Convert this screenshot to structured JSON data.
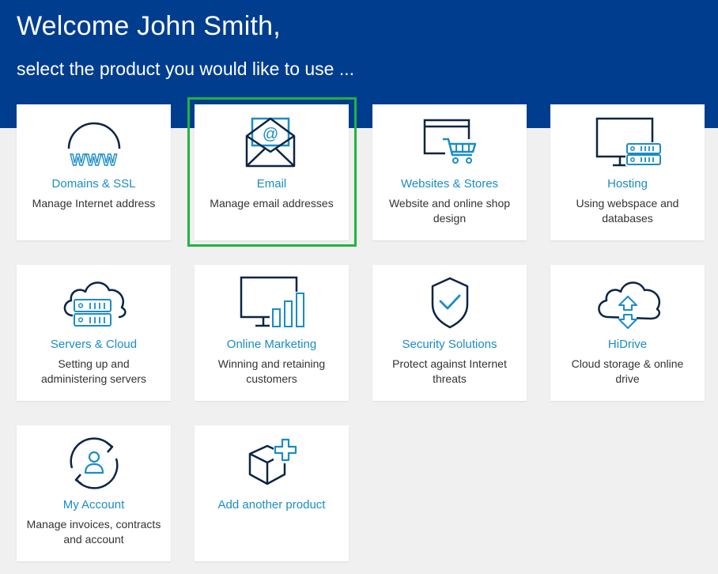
{
  "header": {
    "welcome": "Welcome John Smith,",
    "subtitle": "select the product you would like to use ..."
  },
  "colors": {
    "header_bg": "#003d8f",
    "accent": "#1a8cc6",
    "icon_dark": "#0b2545",
    "selection": "#1fb53f"
  },
  "tiles": [
    {
      "title": "Domains & SSL",
      "desc": "Manage Internet address",
      "icon": "globe-www-icon",
      "www": "WWW"
    },
    {
      "title": "Email",
      "desc": "Manage email addresses",
      "icon": "email-envelope-icon",
      "at": "@",
      "selected": true
    },
    {
      "title": "Websites & Stores",
      "desc": "Website and online shop design",
      "icon": "website-cart-icon"
    },
    {
      "title": "Hosting",
      "desc": "Using webspace and databases",
      "icon": "hosting-server-icon"
    },
    {
      "title": "Servers & Cloud",
      "desc": "Setting up and administering servers",
      "icon": "server-cloud-icon"
    },
    {
      "title": "Online Marketing",
      "desc": "Winning and retaining customers",
      "icon": "marketing-chart-icon"
    },
    {
      "title": "Security Solutions",
      "desc": "Protect against Internet threats",
      "icon": "shield-check-icon"
    },
    {
      "title": "HiDrive",
      "desc": "Cloud storage & online drive",
      "icon": "cloud-drive-icon"
    },
    {
      "title": "My Account",
      "desc": "Manage invoices, contracts and account",
      "icon": "account-user-icon"
    },
    {
      "title": "Add another product",
      "desc": "",
      "icon": "add-product-box-icon"
    }
  ]
}
